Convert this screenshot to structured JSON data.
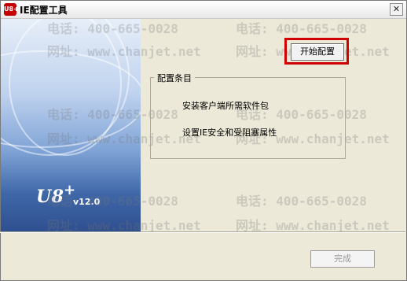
{
  "window": {
    "title": "IE配置工具",
    "icon_text": "U8+",
    "close_symbol": "✕"
  },
  "branding": {
    "product": "U8",
    "plus": "+",
    "version": "v12.0"
  },
  "actions": {
    "start_label": "开始配置",
    "finish_label": "完成",
    "finish_enabled": false
  },
  "config_group": {
    "legend": "配置条目",
    "items": [
      "安装客户端所需软件包",
      "设置IE安全和受阻塞属性"
    ]
  },
  "watermark": {
    "phone": "电话: 400-665-0028",
    "site": "网址: www.chanjet.net"
  },
  "colors": {
    "highlight": "#d10000",
    "panel_blue": "#3f67a8"
  }
}
